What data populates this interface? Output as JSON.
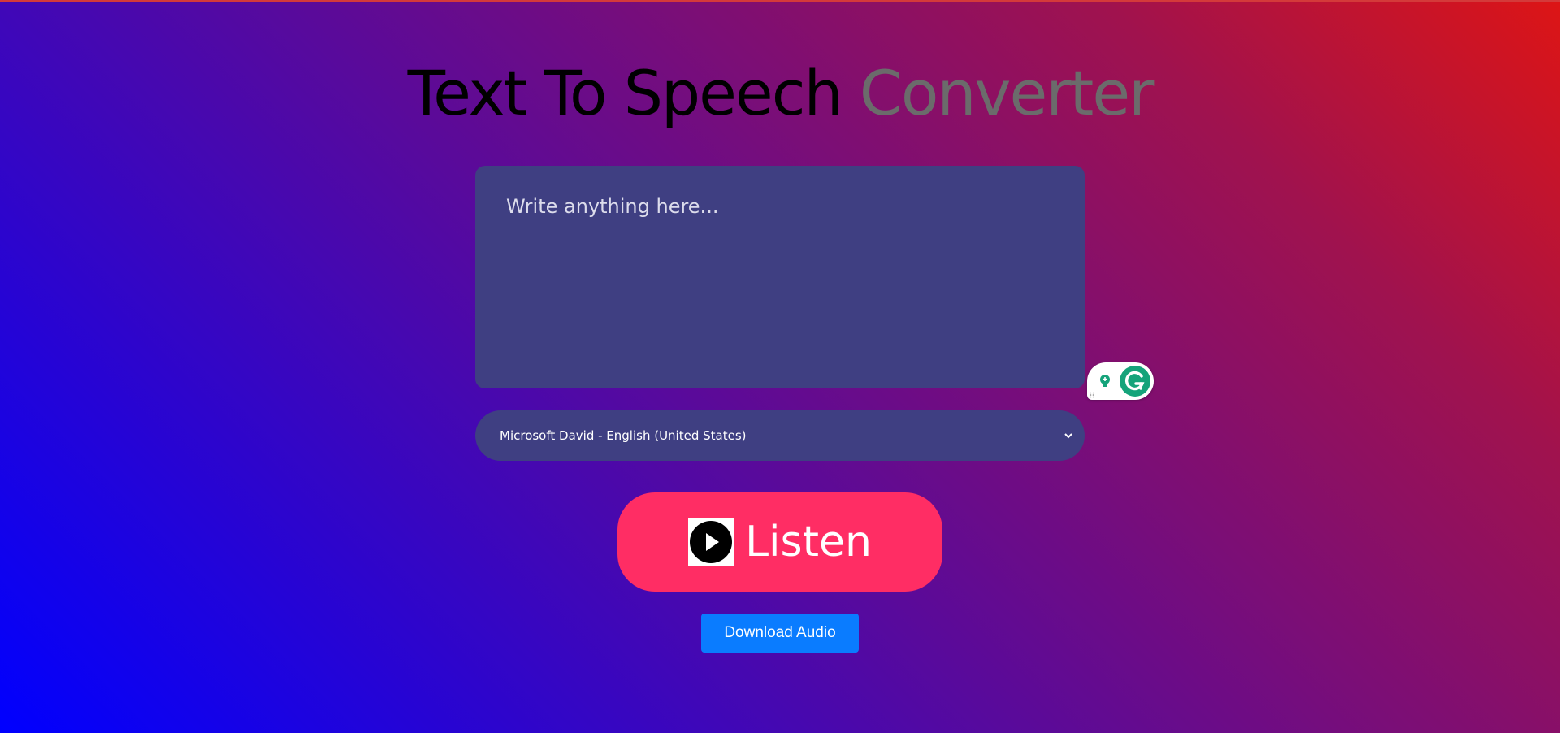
{
  "title": {
    "part1": "Text To Speech",
    "part2": "Converter"
  },
  "textarea": {
    "placeholder": "Write anything here...",
    "value": ""
  },
  "voice_select": {
    "selected": "Microsoft David - English (United States)"
  },
  "listen_button": {
    "label": "Listen",
    "icon": "play-icon"
  },
  "download_button": {
    "label": "Download Audio"
  },
  "colors": {
    "gradient_start": "#0000ff",
    "gradient_end": "#dd1515",
    "panel": "#3f3f82",
    "listen": "#ff2d64",
    "download": "#0a7cff"
  }
}
